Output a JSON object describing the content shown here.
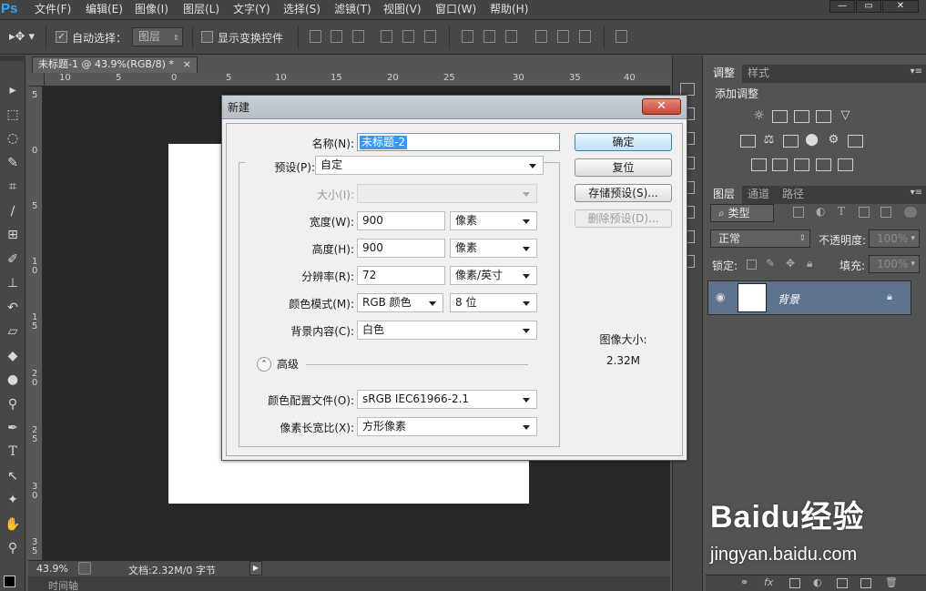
{
  "app": {
    "logo": "Ps"
  },
  "menu": [
    "文件(F)",
    "编辑(E)",
    "图像(I)",
    "图层(L)",
    "文字(Y)",
    "选择(S)",
    "滤镜(T)",
    "视图(V)",
    "窗口(W)",
    "帮助(H)"
  ],
  "window_controls": {
    "minimize": "—",
    "maximize": "▭",
    "close": "✕"
  },
  "options": {
    "auto_select_label": "自动选择：",
    "auto_select_value": "图层",
    "show_transform_label": "显示变换控件"
  },
  "document": {
    "tab_title": "未标题-1 @ 43.9%(RGB/8) *",
    "tab_close": "×",
    "ruler_h": [
      "10",
      "5",
      "0",
      "5",
      "10",
      "15",
      "20",
      "25",
      "30",
      "35",
      "40"
    ],
    "ruler_v": [
      "5",
      "0",
      "5",
      "1\n0",
      "1\n5",
      "2\n0",
      "2\n5",
      "3\n0",
      "3\n5"
    ],
    "zoom": "43.9%",
    "doc_info": "文档:2.32M/0 字节",
    "timeline_label": "时间轴"
  },
  "panels": {
    "adjust_tabs": [
      "调整",
      "样式"
    ],
    "adjust_title": "添加调整",
    "layer_tabs": [
      "图层",
      "通道",
      "路径"
    ],
    "kind_filter": "类型",
    "blend_mode": "正常",
    "opacity_label": "不透明度:",
    "opacity_value": "100%",
    "lock_label": "锁定:",
    "fill_label": "填充:",
    "fill_value": "100%",
    "layer_name": "背景"
  },
  "dialog": {
    "title": "新建",
    "name_label": "名称(N):",
    "name_value": "未标题-2",
    "preset_label": "预设(P):",
    "preset_value": "自定",
    "size_label": "大小(I):",
    "size_value": "",
    "width_label": "宽度(W):",
    "width_value": "900",
    "width_unit": "像素",
    "height_label": "高度(H):",
    "height_value": "900",
    "height_unit": "像素",
    "resolution_label": "分辨率(R):",
    "resolution_value": "72",
    "resolution_unit": "像素/英寸",
    "color_mode_label": "颜色模式(M):",
    "color_mode_value": "RGB 颜色",
    "bit_depth_value": "8 位",
    "background_label": "背景内容(C):",
    "background_value": "白色",
    "advanced_label": "高级",
    "profile_label": "颜色配置文件(O):",
    "profile_value": "sRGB IEC61966-2.1",
    "aspect_label": "像素长宽比(X):",
    "aspect_value": "方形像素",
    "image_size_label": "图像大小:",
    "image_size_value": "2.32M",
    "ok_button": "确定",
    "reset_button": "复位",
    "save_preset_button": "存储预设(S)...",
    "delete_preset_button": "删除预设(D)..."
  },
  "watermark": {
    "brand": "Baidu经验",
    "url": "jingyan.baidu.com"
  }
}
